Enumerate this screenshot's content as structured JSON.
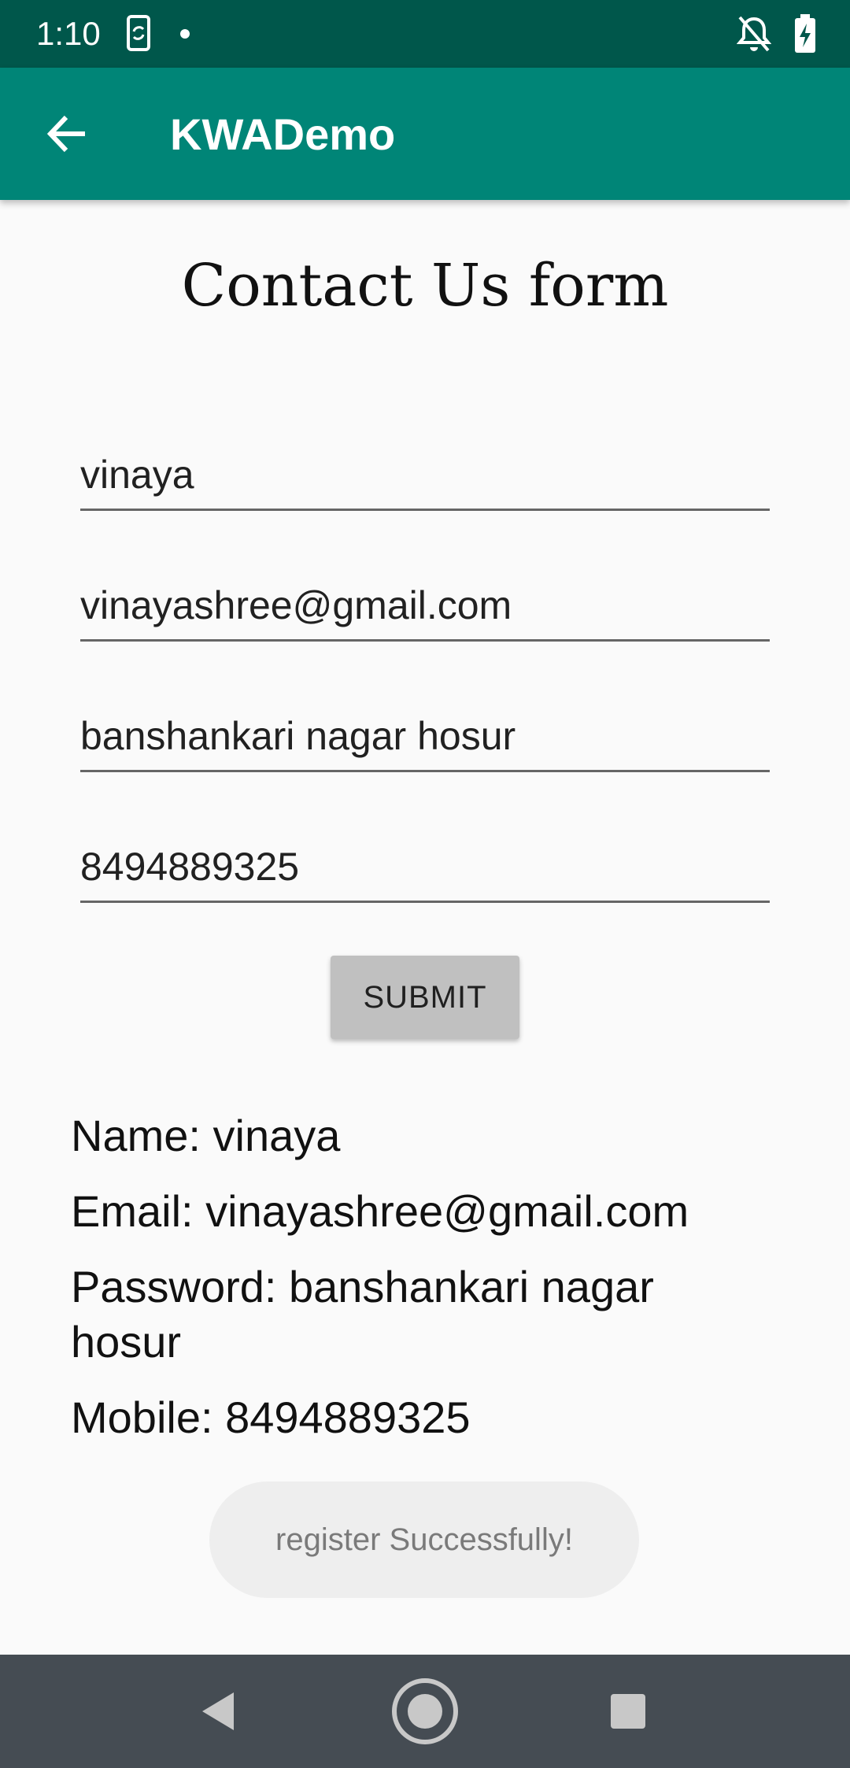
{
  "status_bar": {
    "time": "1:10",
    "icons": [
      "phone-sync-icon",
      "notification-dot-icon",
      "notifications-off-icon",
      "battery-charging-icon"
    ]
  },
  "app_bar": {
    "title": "KWADemo",
    "back_icon": "arrow-back-icon",
    "color": "#008577"
  },
  "form": {
    "title": "Contact Us form",
    "name_value": "vinaya",
    "email_value": "vinayashree@gmail.com",
    "password_value": "banshankari nagar hosur",
    "mobile_value": "8494889325",
    "submit_label": "SUBMIT"
  },
  "results": {
    "name": "Name: vinaya",
    "email": "Email: vinayashree@gmail.com",
    "password": "Password: banshankari nagar hosur",
    "mobile": "Mobile: 8494889325"
  },
  "toast": {
    "message": "register Successfully!"
  },
  "nav_bar": {
    "icons": [
      "nav-back-icon",
      "nav-home-icon",
      "nav-recents-icon"
    ]
  }
}
